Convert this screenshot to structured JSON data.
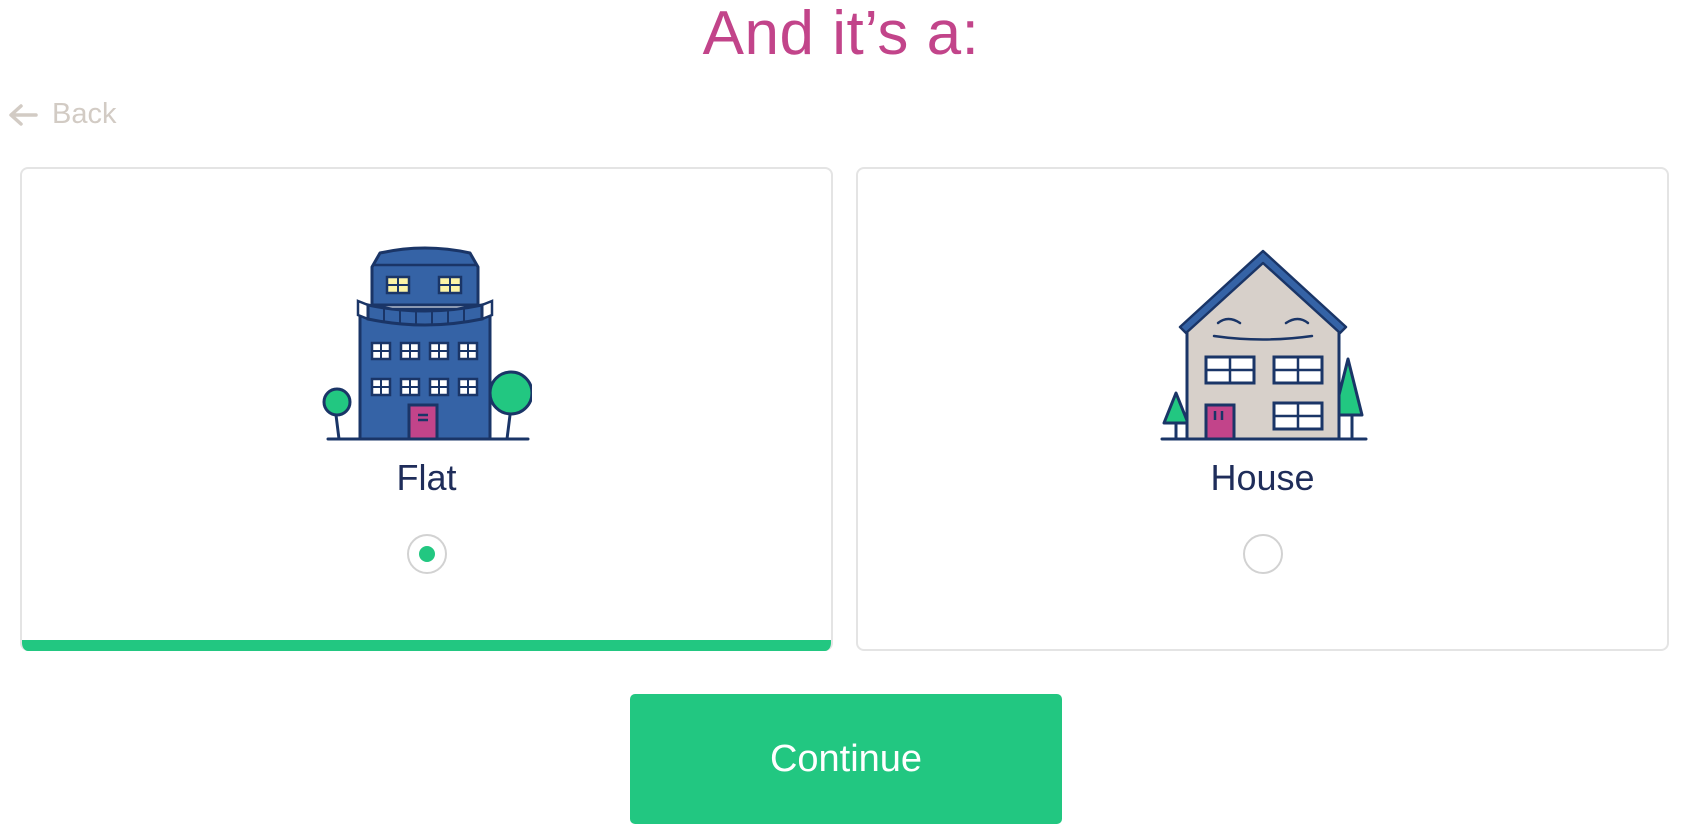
{
  "header": {
    "title": "And it’s a:"
  },
  "nav": {
    "back_label": "Back",
    "back_icon": "arrow-left-icon"
  },
  "options": [
    {
      "label": "Flat",
      "icon": "apartment-building-icon",
      "selected": true
    },
    {
      "label": "House",
      "icon": "house-icon",
      "selected": false
    }
  ],
  "actions": {
    "continue_label": "Continue"
  },
  "colors": {
    "title": "#c2448a",
    "accent_green": "#22c781",
    "back_text": "#d2cbc4",
    "label_text": "#1f2d5a",
    "card_border": "#e4e4e4",
    "building_blue": "#3563a6",
    "outline_navy": "#1a3567",
    "door_pink": "#c2448a",
    "house_wall": "#d7d0ca",
    "window_yellow": "#fbf3a6"
  }
}
